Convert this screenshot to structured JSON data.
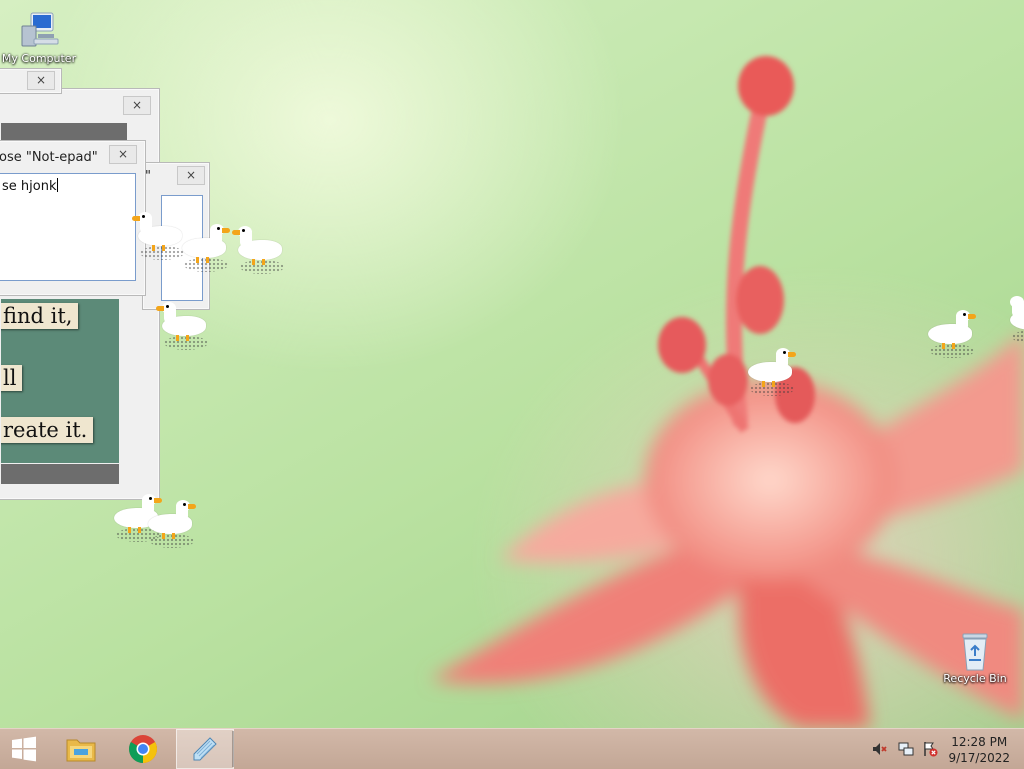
{
  "desktop": {
    "icons": [
      {
        "name": "My Computer"
      },
      {
        "name": "Recycle Bin"
      }
    ]
  },
  "windows": {
    "close_glyph": "×",
    "dialog_title": "ose \"Not-epad\"",
    "dialog_text": "se hjonk",
    "back_title_fragment": "\"",
    "meme_lines": [
      "find it,",
      "ll",
      "reate it."
    ]
  },
  "taskbar": {
    "start": {
      "icon": "windows-logo-icon"
    },
    "pinned": [
      {
        "name": "file-explorer",
        "icon": "folder-icon"
      },
      {
        "name": "chrome",
        "icon": "chrome-icon"
      },
      {
        "name": "notepad",
        "icon": "notepad-icon",
        "active": true
      }
    ],
    "tray": [
      {
        "icon": "volume-muted-icon"
      },
      {
        "icon": "network-icon"
      },
      {
        "icon": "action-center-flag-icon"
      }
    ],
    "clock": {
      "time": "12:28 PM",
      "date": "9/17/2022"
    }
  },
  "colors": {
    "taskbar": "#c9ad9c",
    "wallpaper_green": "#b9e1a0",
    "flower_pink": "#f08c86",
    "goose_beak": "#f3a51a"
  }
}
